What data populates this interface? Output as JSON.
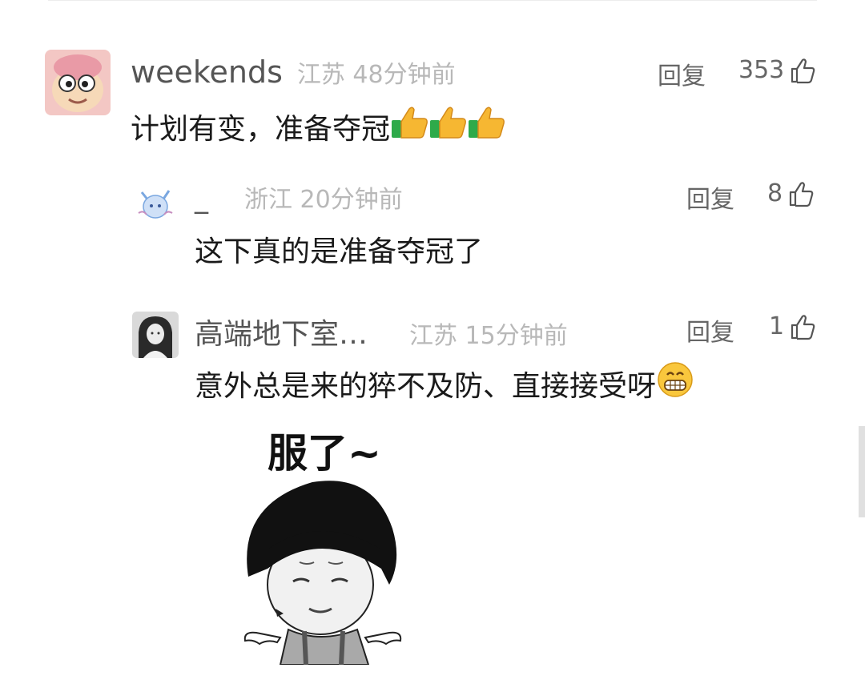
{
  "comments": [
    {
      "user": "weekends",
      "location_time": "江苏 48分钟前",
      "reply_label": "回复",
      "likes": "353",
      "text": "计划有变，准备夺冠",
      "emojis": [
        "thumbs-up-emoji",
        "thumbs-up-emoji",
        "thumbs-up-emoji"
      ]
    },
    {
      "user": "_",
      "location_time": "浙江 20分钟前",
      "reply_label": "回复",
      "likes": "8",
      "text": "这下真的是准备夺冠了"
    },
    {
      "user": "高端地下室…",
      "location_time": "江苏 15分钟前",
      "reply_label": "回复",
      "likes": "1",
      "text": "意外总是来的猝不及防、直接接受呀",
      "emojis": [
        "grinning-emoji"
      ],
      "sticker_caption": "服了~"
    }
  ]
}
